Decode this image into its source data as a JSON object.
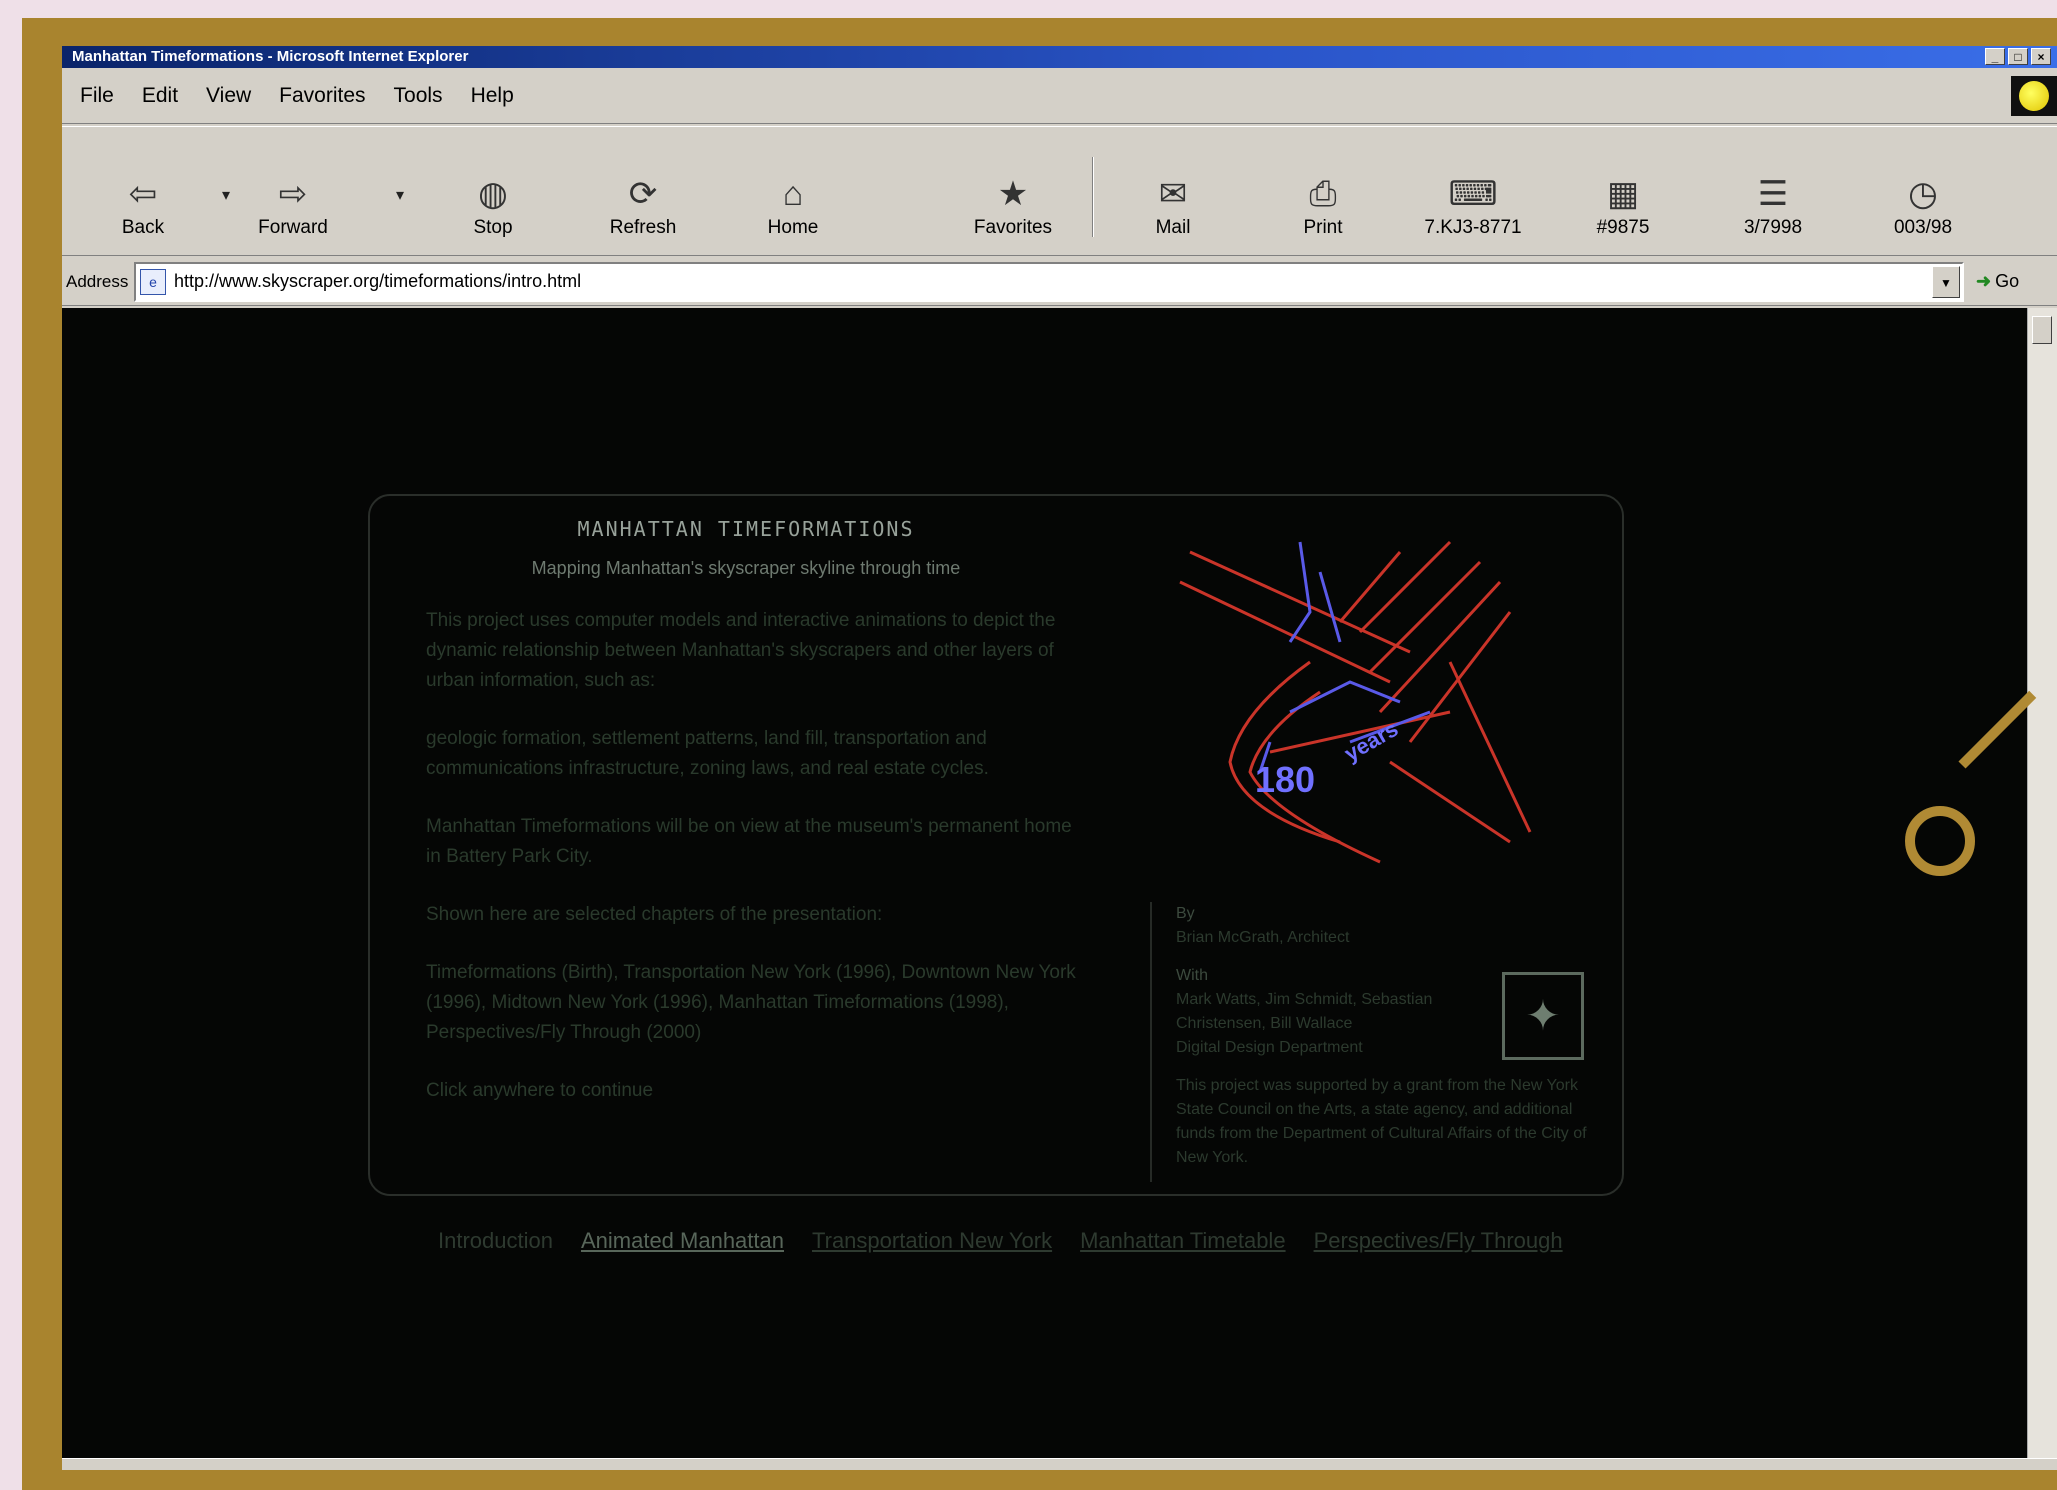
{
  "browser": {
    "title": "Manhattan Timeformations - Microsoft Internet Explorer",
    "menu": [
      "File",
      "Edit",
      "View",
      "Favorites",
      "Tools",
      "Help"
    ],
    "toolbar": {
      "back": "Back",
      "forward": "Forward",
      "stop": "Stop",
      "refresh": "Refresh",
      "home": "Home",
      "favorites": "Favorites",
      "mail": "Mail",
      "print": "Print",
      "extra1": "7.KJ3-8771",
      "extra2": "#9875",
      "extra3": "3/7998",
      "extra4": "003/98"
    },
    "address_label": "Address",
    "address_value": "http://www.skyscraper.org/timeformations/intro.html",
    "go_label": "Go"
  },
  "page": {
    "site_title": "MANHATTAN TIMEFORMATIONS",
    "site_subtitle": "Mapping Manhattan's skyscraper skyline through time",
    "paragraphs": [
      "This project uses computer models and interactive animations to depict the dynamic relationship between Manhattan's skyscrapers and other layers of urban information, such as:",
      "geologic formation, settlement patterns, land fill, transportation and communications infrastructure, zoning laws, and real estate cycles.",
      "Manhattan Timeformations will be on view at the museum's permanent home in Battery Park City.",
      "Shown here are selected chapters of the presentation:",
      "Timeformations (Birth), Transportation New York (1996), Downtown New York (1996), Midtown New York (1996), Manhattan Timeformations (1998), Perspectives/Fly Through (2000)",
      "Click anywhere to continue"
    ],
    "info": {
      "by_label": "By",
      "by_value": "Brian McGrath, Architect",
      "with_label": "With",
      "with_lines": [
        "Mark Watts, Jim Schmidt, Sebastian",
        "Christensen, Bill Wallace",
        "Digital Design Department"
      ],
      "credit": "This project was supported by a grant from the New York State Council on the Arts, a state agency, and additional funds from the Department of Cultural Affairs of the City of New York."
    },
    "nav": {
      "intro": "Introduction",
      "items": [
        "Animated Manhattan",
        "Transportation New York",
        "Manhattan Timetable",
        "Perspectives/Fly Through"
      ]
    },
    "colors": {
      "background": "#050605",
      "map_red": "#e03a2e",
      "map_blue": "#5a5ae8",
      "frame": "#a9842e"
    }
  }
}
